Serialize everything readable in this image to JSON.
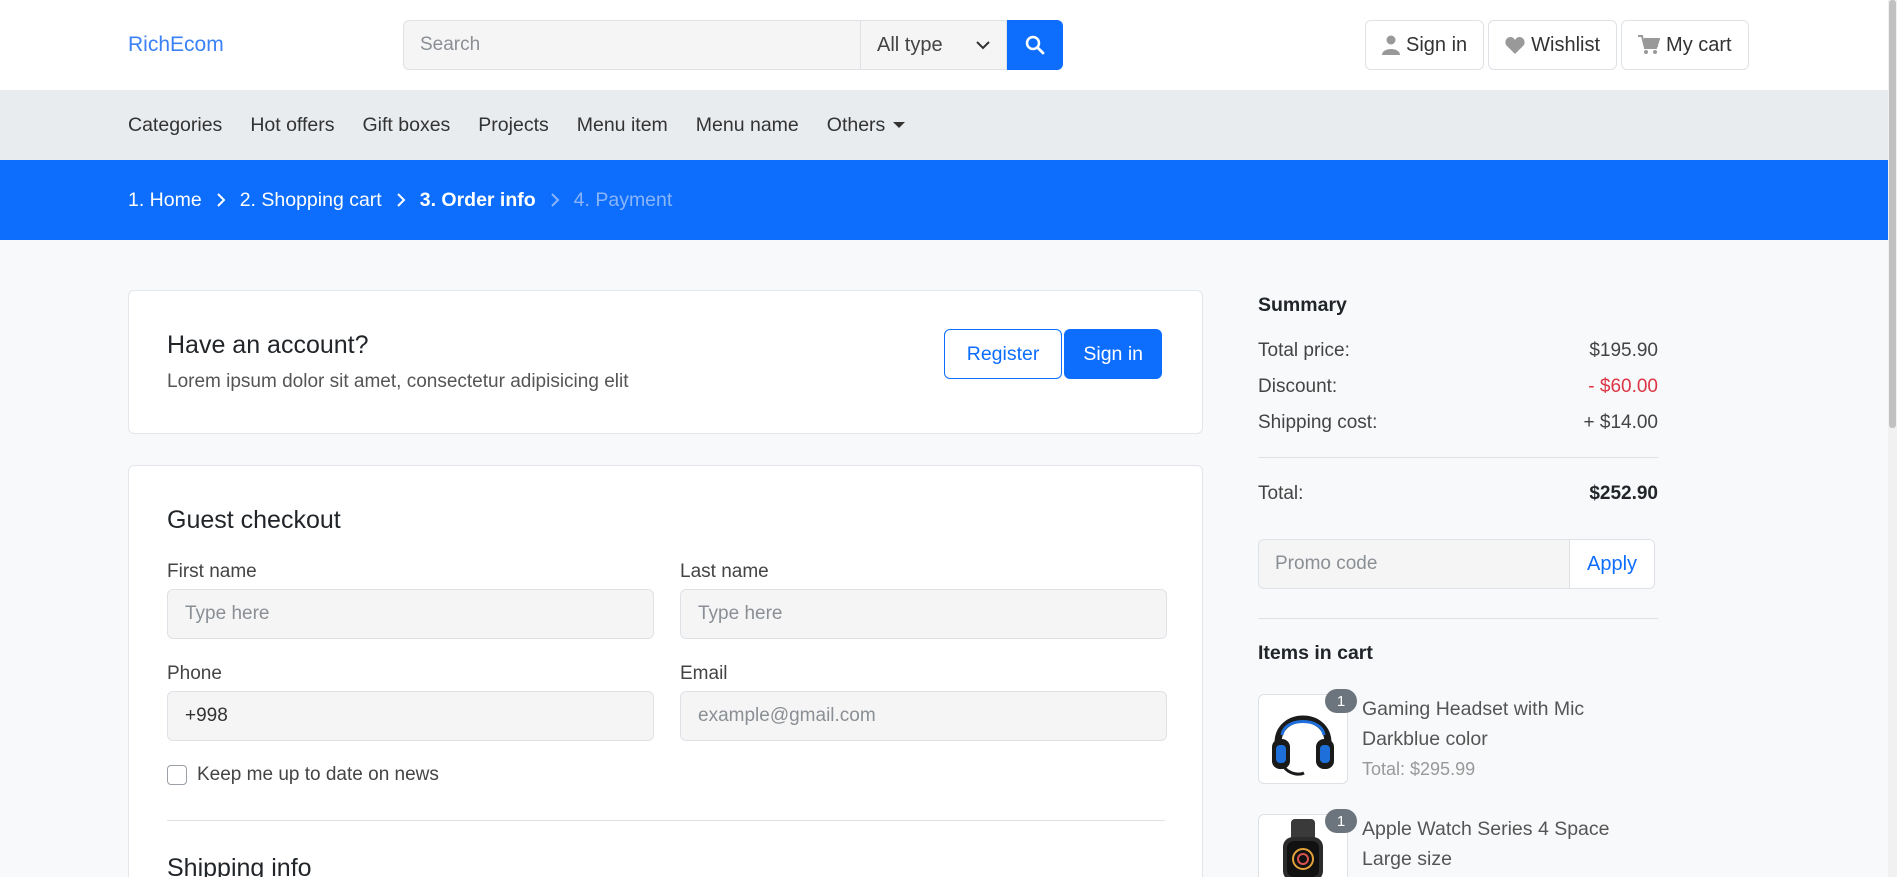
{
  "header": {
    "brand": "RichEcom",
    "search_placeholder": "Search",
    "type_select": "All type",
    "buttons": [
      {
        "label": "Sign in",
        "icon": "user-icon"
      },
      {
        "label": "Wishlist",
        "icon": "heart-icon"
      },
      {
        "label": "My cart",
        "icon": "cart-icon"
      }
    ]
  },
  "nav": {
    "items": [
      "Categories",
      "Hot offers",
      "Gift boxes",
      "Projects",
      "Menu item",
      "Menu name",
      "Others"
    ]
  },
  "breadcrumb": {
    "steps": [
      "1. Home",
      "2. Shopping cart",
      "3. Order info",
      "4. Payment"
    ],
    "active_index": 2
  },
  "account": {
    "title": "Have an account?",
    "subtitle": "Lorem ipsum dolor sit amet, consectetur adipisicing elit",
    "register_label": "Register",
    "signin_label": "Sign in"
  },
  "guest": {
    "title": "Guest checkout",
    "first_name_label": "First name",
    "first_name_placeholder": "Type here",
    "last_name_label": "Last name",
    "last_name_placeholder": "Type here",
    "phone_label": "Phone",
    "phone_value": "+998",
    "email_label": "Email",
    "email_placeholder": "example@gmail.com",
    "newsletter_label": "Keep me up to date on news",
    "shipping_title": "Shipping info"
  },
  "summary": {
    "title": "Summary",
    "total_price_label": "Total price:",
    "total_price": "$195.90",
    "discount_label": "Discount:",
    "discount": "- $60.00",
    "shipping_label": "Shipping cost:",
    "shipping": "+ $14.00",
    "total_label": "Total:",
    "total": "$252.90",
    "promo_placeholder": "Promo code",
    "apply_label": "Apply",
    "items_title": "Items in cart",
    "items": [
      {
        "name": "Gaming Headset with Mic Darkblue color",
        "total": "Total: $295.99",
        "qty": "1"
      },
      {
        "name": "Apple Watch Series 4 Space Large size",
        "total": "",
        "qty": "1"
      }
    ]
  },
  "colors": {
    "primary": "#0d6efd",
    "danger": "#dc3545",
    "nav_bg": "#e9ecef"
  }
}
